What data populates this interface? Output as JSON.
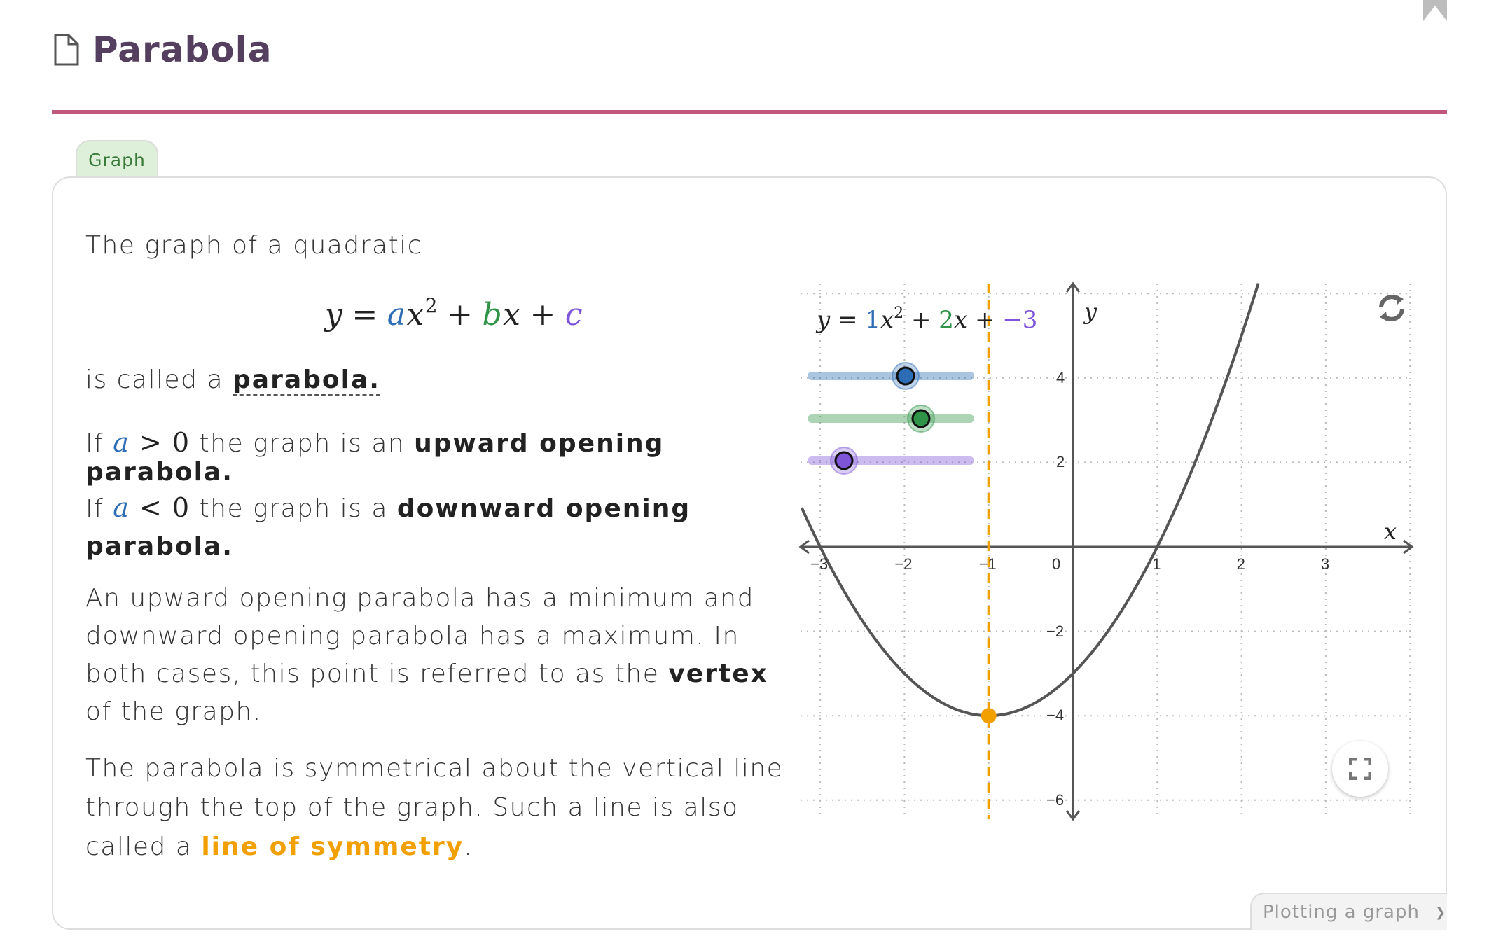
{
  "header": {
    "title": "Parabola",
    "page_icon": "document-icon",
    "bookmark_icon": "bookmark-icon"
  },
  "tabs": [
    {
      "label": "Graph",
      "active": true
    }
  ],
  "content": {
    "p1": "The graph of a quadratic",
    "formula": {
      "y": "y",
      "eq": "=",
      "a": "a",
      "x": "x",
      "sq": "2",
      "plus": "+",
      "b": "b",
      "x2": "x",
      "plus2": "+",
      "c": "c"
    },
    "p2_prefix": "is called a ",
    "p2_term": "parabola.",
    "p3": {
      "if": "If ",
      "var": "a",
      "rel": " > 0",
      "mid": " the graph is an ",
      "term": "upward opening parabola."
    },
    "p4": {
      "if": "If ",
      "var": "a",
      "rel": " < 0",
      "mid": " the graph is a ",
      "term": "downward opening parabola."
    },
    "p5": {
      "pre": "An upward opening parabola has a minimum and downward opening parabola has a maximum. In both cases, this point is referred to as the ",
      "term": "vertex",
      "post": " of the graph."
    },
    "p6": {
      "pre": "The parabola is symmetrical about the vertical line through the top of the graph. Such a line is also called a ",
      "link": "line of symmetry",
      "post": "."
    }
  },
  "colors": {
    "a": "#2d6db5",
    "b": "#2f9447",
    "c": "#7f55d8",
    "symmetry": "#f1a000",
    "curve": "#555555",
    "accent_rule": "#c0567a",
    "title": "#543f5f"
  },
  "graph": {
    "equation": {
      "y": "y",
      "eq": "=",
      "a": "1",
      "x": "x",
      "sq": "2",
      "plus": "+",
      "b": "2",
      "x2": "x",
      "plus2": "+",
      "c": "−3"
    },
    "x_axis_label": "x",
    "y_axis_label": "y",
    "sliders": [
      {
        "name": "a",
        "value": 1,
        "color": "#2d6db5"
      },
      {
        "name": "b",
        "value": 2,
        "color": "#2f9447"
      },
      {
        "name": "c",
        "value": -3,
        "color": "#7f55d8"
      }
    ],
    "refresh_icon": "refresh-icon",
    "fullscreen_icon": "fullscreen-icon"
  },
  "chart_data": {
    "type": "line",
    "title": "y = 1x² + 2x + −3",
    "function": {
      "a": 1,
      "b": 2,
      "c": -3
    },
    "vertex": [
      -1,
      -4
    ],
    "line_of_symmetry_x": -1,
    "xlabel": "x",
    "ylabel": "y",
    "xlim": [
      -3.2,
      4
    ],
    "ylim": [
      -6.4,
      6
    ],
    "x_ticks": [
      "−3",
      "−2",
      "−1",
      "0",
      "1",
      "2",
      "3"
    ],
    "x_tick_values": [
      -3,
      -2,
      -1,
      0,
      1,
      2,
      3
    ],
    "y_ticks": [
      "4",
      "2",
      "−2",
      "−4",
      "−6"
    ],
    "y_tick_values": [
      4,
      2,
      -2,
      -4,
      -6
    ],
    "grid": true
  },
  "footer": {
    "dropdown_label": "Plotting a graph"
  }
}
